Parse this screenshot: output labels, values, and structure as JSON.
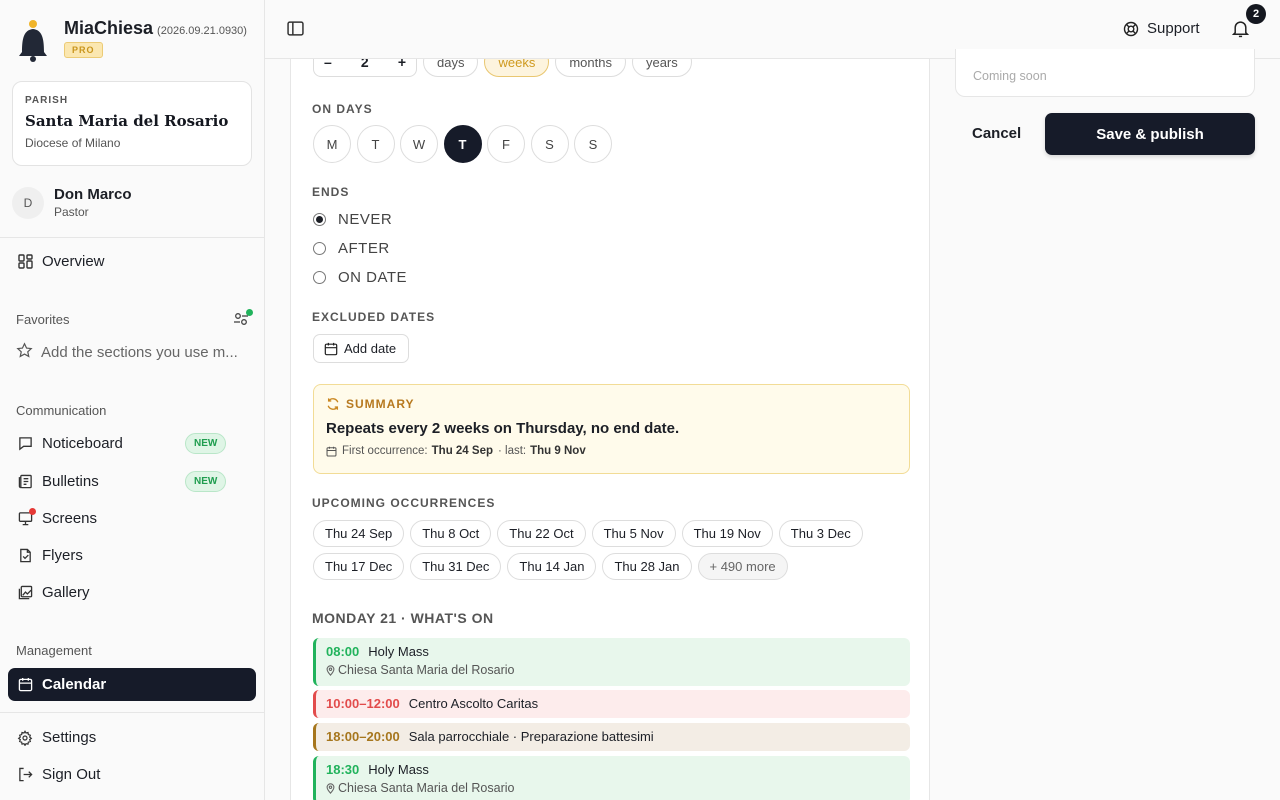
{
  "app": {
    "name": "MiaChiesa",
    "version": "(2026.09.21.0930)",
    "plan": "PRO"
  },
  "parish": {
    "kicker": "PARISH",
    "name": "Santa Maria del Rosario",
    "diocese": "Diocese of Milano"
  },
  "user": {
    "initial": "D",
    "name": "Don Marco",
    "role": "Pastor"
  },
  "nav": {
    "overview": "Overview",
    "favorites_label": "Favorites",
    "favorites_hint": "Add the sections you use m...",
    "communication_label": "Communication",
    "noticeboard": "Noticeboard",
    "bulletins": "Bulletins",
    "new_badge": "NEW",
    "screens": "Screens",
    "flyers": "Flyers",
    "gallery": "Gallery",
    "management_label": "Management",
    "calendar": "Calendar",
    "settings": "Settings",
    "sign_out": "Sign Out"
  },
  "topbar": {
    "support": "Support",
    "notification_count": "2"
  },
  "recurrence": {
    "interval_value": "2",
    "minus": "–",
    "plus": "+",
    "units": [
      "days",
      "weeks",
      "months",
      "years"
    ],
    "selected_unit": "weeks",
    "on_days_label": "ON DAYS",
    "days": [
      "M",
      "T",
      "W",
      "T",
      "F",
      "S",
      "S"
    ],
    "selected_day_index": 3,
    "ends_label": "ENDS",
    "ends_options": [
      "NEVER",
      "AFTER",
      "ON DATE"
    ],
    "ends_selected": "NEVER",
    "excluded_label": "EXCLUDED DATES",
    "add_date": "Add date"
  },
  "summary": {
    "title": "SUMMARY",
    "text": "Repeats every 2 weeks on Thursday, no end date.",
    "first_label": "First occurrence:",
    "first_value": "Thu 24 Sep",
    "last_label": "· last:",
    "last_value": "Thu 9 Nov"
  },
  "upcoming": {
    "label": "UPCOMING OCCURRENCES",
    "row1": [
      "Thu 24 Sep",
      "Thu 8 Oct",
      "Thu 22 Oct",
      "Thu 5 Nov",
      "Thu 19 Nov",
      "Thu 3 Dec"
    ],
    "row2": [
      "Thu 17 Dec",
      "Thu 31 Dec",
      "Thu 14 Jan",
      "Thu 28 Jan"
    ],
    "more": "+ 490 more"
  },
  "whats_on": {
    "title": "MONDAY 21 · WHAT'S ON",
    "events": [
      {
        "time": "08:00",
        "title": "Holy Mass",
        "location": "Chiesa Santa Maria del Rosario",
        "color": "#21b35c"
      },
      {
        "time": "10:00–12:00",
        "title": "Centro Ascolto Caritas",
        "location": "",
        "color": "#e24b4b"
      },
      {
        "time": "18:00–20:00",
        "title": "Sala parrocchiale · Preparazione battesimi",
        "location": "",
        "color": "#a6761d"
      },
      {
        "time": "18:30",
        "title": "Holy Mass",
        "location": "Chiesa Santa Maria del Rosario",
        "color": "#21b35c"
      }
    ]
  },
  "right_panel": {
    "coming_soon": "Coming soon",
    "cancel": "Cancel",
    "save": "Save & publish"
  }
}
